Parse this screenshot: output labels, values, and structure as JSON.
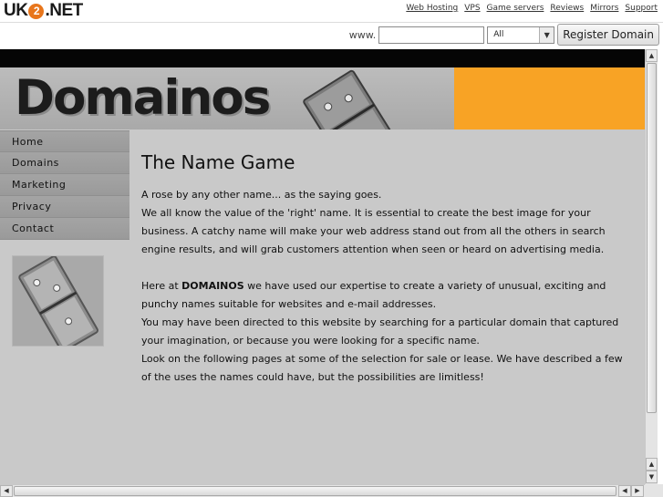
{
  "topbar": {
    "logo_pre": "UK",
    "logo_mid": "2",
    "logo_post": ".NET",
    "links": [
      "Web Hosting",
      "VPS",
      "Game servers",
      "Reviews",
      "Mirrors",
      "Support"
    ],
    "www_label": "www.",
    "domain_input_value": "",
    "tld_selected": "All",
    "register_label": "Register Domain"
  },
  "site": {
    "logo_text": "Domainos",
    "accent_color": "#f8a325",
    "nav": [
      "Home",
      "Domains",
      "Marketing",
      "Privacy",
      "Contact"
    ]
  },
  "content": {
    "title": "The Name Game",
    "p1": "A rose by any other name... as the saying goes.",
    "p2": "We all know the value of the 'right' name. It is essential to create the best image for your business. A catchy name will make your web address stand out from all the others in search engine results, and will grab customers attention when seen or heard on advertising media.",
    "p3_pre": "Here at ",
    "p3_bold": "DOMAINOS",
    "p3_post": " we have used our expertise to create a variety of unusual, exciting and punchy names suitable for websites and e-mail addresses.",
    "p4": "You may have been directed to this website by searching for a particular domain that captured your imagination, or because you were looking for a specific name.",
    "p5": "Look on the following pages at some of the selection for sale or lease. We have described a few of the uses the names could have, but the possibilities are limitless!"
  }
}
